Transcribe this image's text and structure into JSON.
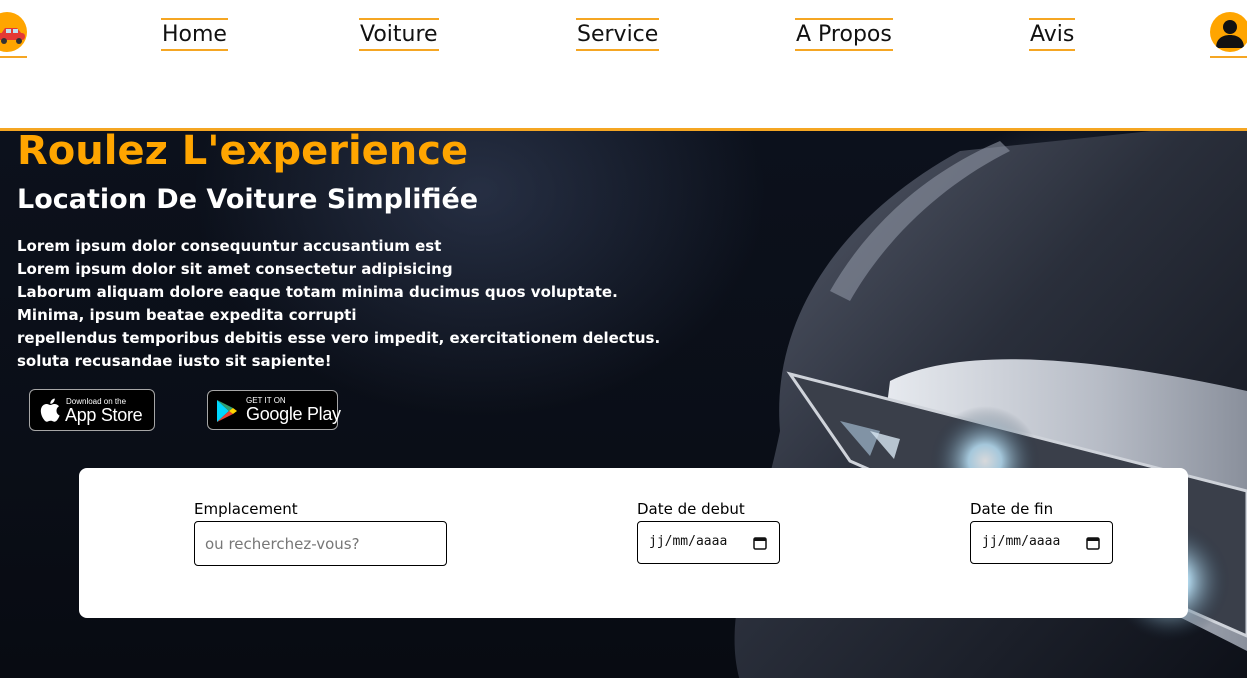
{
  "nav": {
    "links": [
      {
        "label": "Home"
      },
      {
        "label": "Voiture"
      },
      {
        "label": "Service"
      },
      {
        "label": "A Propos"
      },
      {
        "label": "Avis"
      }
    ],
    "logo_icon": "car-icon",
    "avatar_icon": "user-icon"
  },
  "hero": {
    "title": "Roulez L'experience",
    "subtitle": "Location De Voiture Simplifiée",
    "text_lines": [
      "Lorem ipsum dolor consequuntur accusantium est",
      "Lorem ipsum dolor sit amet consectetur adipisicing",
      "Laborum aliquam dolore eaque totam minima ducimus quos voluptate.",
      "Minima, ipsum beatae expedita corrupti",
      "repellendus temporibus debitis esse vero impedit, exercitationem delectus.",
      "soluta recusandae iusto sit sapiente!"
    ]
  },
  "badges": {
    "app_store": {
      "small": "Download on the",
      "big": "App Store",
      "icon": "apple-icon"
    },
    "google_play": {
      "small": "GET IT ON",
      "big": "Google Play",
      "icon": "google-play-icon"
    }
  },
  "search": {
    "location_label": "Emplacement",
    "location_placeholder": "ou recherchez-vous?",
    "location_value": "",
    "start_label": "Date de debut",
    "start_value": "jj/mm/aaaa",
    "end_label": "Date de fin",
    "end_value": "jj/mm/aaaa",
    "calendar_icon": "calendar-icon"
  },
  "colors": {
    "accent": "#ffa500",
    "nav_border": "#f5a623",
    "hero_bg": "#0a0e17",
    "panel_bg": "#ffffff"
  }
}
